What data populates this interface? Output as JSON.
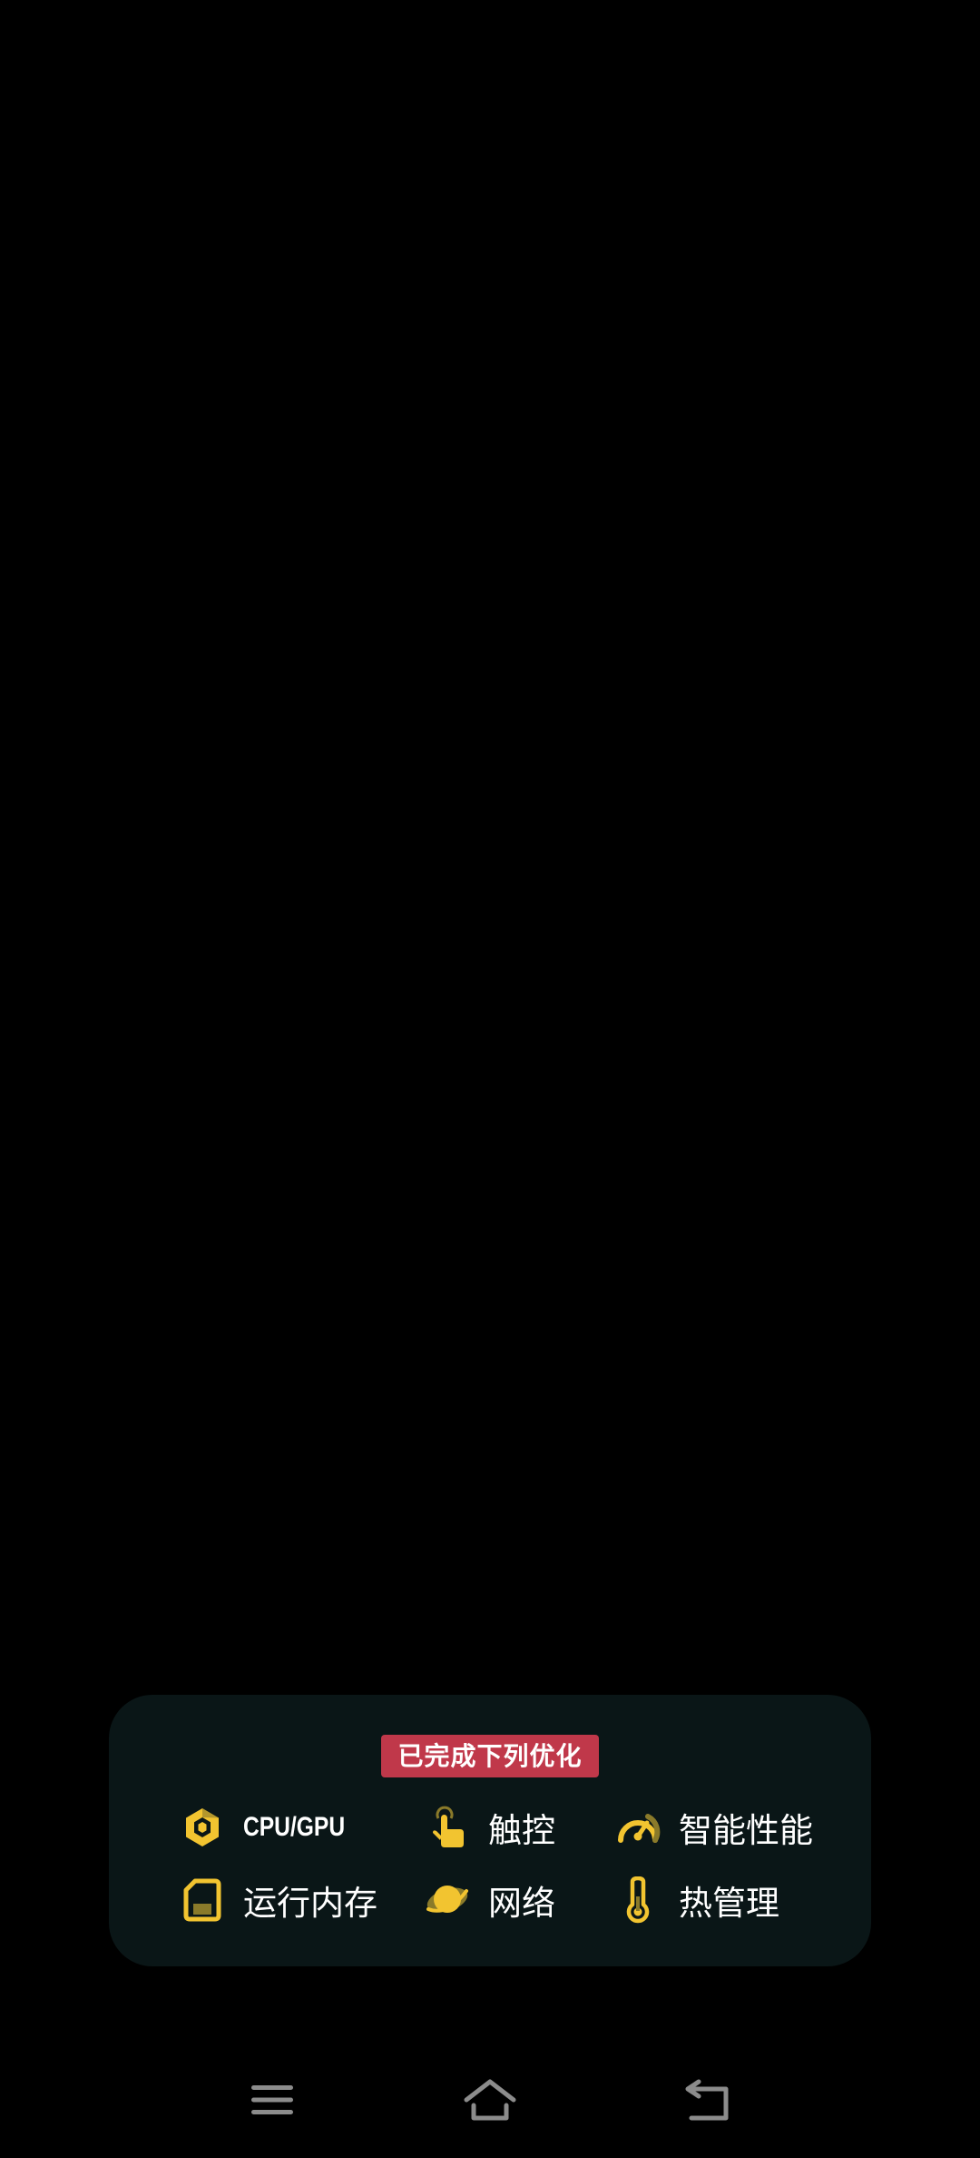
{
  "toast": {
    "title": "已完成下列优化",
    "items": [
      {
        "label": "CPU/GPU",
        "icon": "cpu-hexagon-icon"
      },
      {
        "label": "触控",
        "icon": "touch-hand-icon"
      },
      {
        "label": "智能性能",
        "icon": "speedometer-icon"
      },
      {
        "label": "运行内存",
        "icon": "memory-card-icon"
      },
      {
        "label": "网络",
        "icon": "planet-icon"
      },
      {
        "label": "热管理",
        "icon": "thermometer-icon"
      }
    ],
    "colors": {
      "background": "#0a1617",
      "badge": "#c0384a",
      "icon": "#f2c430"
    }
  },
  "navbar": {
    "buttons": [
      "menu-icon",
      "home-icon",
      "back-icon"
    ]
  }
}
